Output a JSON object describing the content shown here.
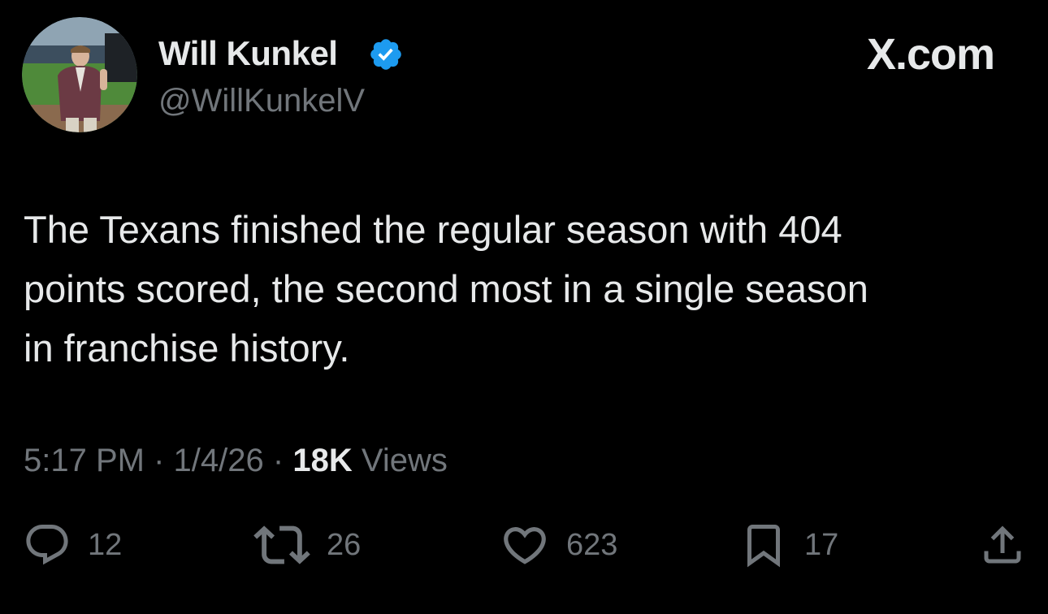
{
  "author": {
    "name": "Will Kunkel",
    "handle": "@WillKunkelV",
    "verified": true
  },
  "brand": "X.com",
  "tweet": {
    "text": "The Texans finished the regular season with 404\npoints scored, the second most in a single season\nin franchise history.",
    "time": "5:17 PM",
    "date": "1/4/26",
    "views_count": "18K",
    "views_label": "Views",
    "separator": "·"
  },
  "actions": {
    "replies": "12",
    "reposts": "26",
    "likes": "623",
    "bookmarks": "17"
  },
  "icons": {
    "reply": "speech-bubble-icon",
    "repost": "repost-arrows-icon",
    "like": "heart-icon",
    "bookmark": "bookmark-icon",
    "share": "share-upload-icon",
    "verified": "verified-badge-icon"
  },
  "colors": {
    "background": "#000000",
    "text_primary": "#e7e9ea",
    "text_secondary": "#71767b",
    "verified_blue": "#1d9bf0"
  }
}
